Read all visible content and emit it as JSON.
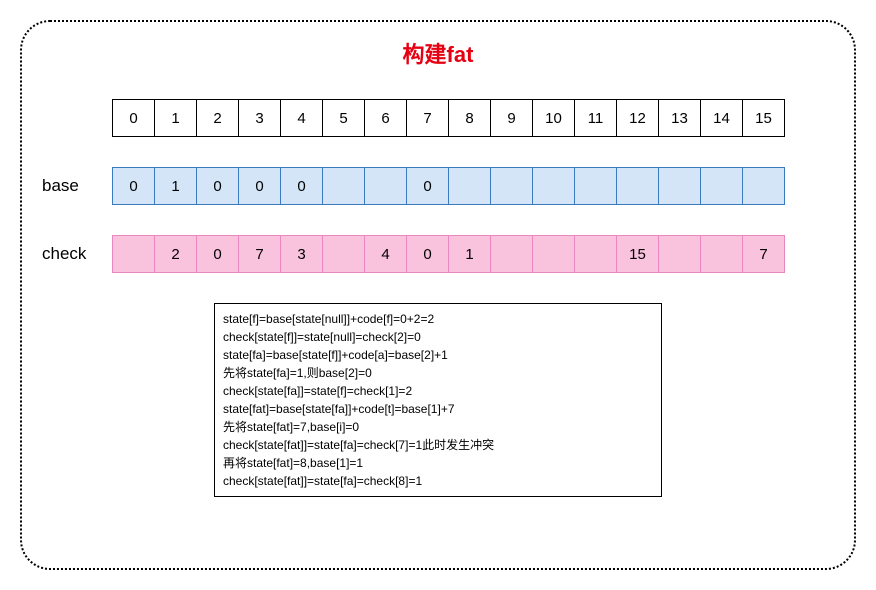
{
  "title": "构建fat",
  "labels": {
    "base": "base",
    "check": "check"
  },
  "chart_data": {
    "type": "table",
    "title": "构建fat",
    "index": [
      "0",
      "1",
      "2",
      "3",
      "4",
      "5",
      "6",
      "7",
      "8",
      "9",
      "10",
      "11",
      "12",
      "13",
      "14",
      "15"
    ],
    "base": [
      "0",
      "1",
      "0",
      "0",
      "0",
      "",
      "",
      "0",
      "",
      "",
      "",
      "",
      "",
      "",
      "",
      ""
    ],
    "check": [
      "",
      "2",
      "0",
      "7",
      "3",
      "",
      "4",
      "0",
      "1",
      "",
      "",
      "",
      "15",
      "",
      "",
      "7"
    ]
  },
  "textbox": [
    "state[f]=base[state[null]]+code[f]=0+2=2",
    "check[state[f]]=state[null]=check[2]=0",
    "state[fa]=base[state[f]]+code[a]=base[2]+1",
    "先将state[fa]=1,则base[2]=0",
    "check[state[fa]]=state[f]=check[1]=2",
    "state[fat]=base[state[fa]]+code[t]=base[1]+7",
    "先将state[fat]=7,base[i]=0",
    "check[state[fat]]=state[fa]=check[7]=1此时发生冲突",
    "再将state[fat]=8,base[1]=1",
    "check[state[fat]]=state[fa]=check[8]=1"
  ]
}
